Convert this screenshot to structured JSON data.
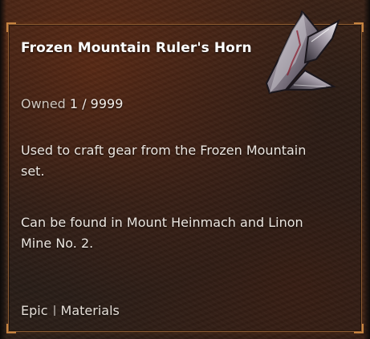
{
  "item": {
    "name": "Frozen Mountain Ruler's Horn",
    "icon": "frozen-horn-icon",
    "owned_label": "Owned",
    "owned_count": "1 / 9999",
    "description_1": "Used to craft gear from the Frozen Mountain set.",
    "description_2": "Can be found in Mount Heinmach and Linon Mine No. 2.",
    "rarity": "Epic",
    "category": "Materials"
  },
  "colors": {
    "frame": "#8a5a30",
    "title": "#ffffff",
    "text": "#ece6e0"
  }
}
